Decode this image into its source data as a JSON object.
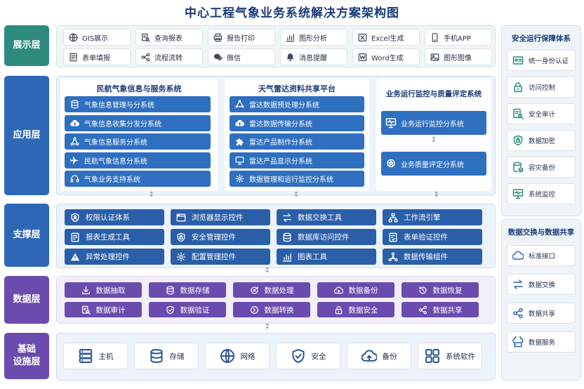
{
  "title": "中心工程气象业务系统解决方案架构图",
  "colors": {
    "teal": "#2f8a7e",
    "blue": "#2d67b5",
    "purple": "#6b4bae",
    "btn_blue": "#2f6fc0"
  },
  "layers": {
    "display": "展示层",
    "application": "应用层",
    "support": "支撑层",
    "data": "数据层",
    "infra_line1": "基础",
    "infra_line2": "设施层"
  },
  "display_items": [
    {
      "label": "GIS展示",
      "icon": "globe-icon"
    },
    {
      "label": "查询报表",
      "icon": "search-report-icon"
    },
    {
      "label": "报告打印",
      "icon": "printer-icon"
    },
    {
      "label": "图形分析",
      "icon": "bar-chart-icon"
    },
    {
      "label": "Excel生成",
      "icon": "excel-icon"
    },
    {
      "label": "手机APP",
      "icon": "phone-icon"
    },
    {
      "label": "表单填报",
      "icon": "form-icon"
    },
    {
      "label": "流程流转",
      "icon": "flow-icon"
    },
    {
      "label": "微信",
      "icon": "wechat-icon"
    },
    {
      "label": "消息提醒",
      "icon": "bell-icon"
    },
    {
      "label": "Word生成",
      "icon": "word-icon"
    },
    {
      "label": "图形图像",
      "icon": "image-icon"
    }
  ],
  "app": {
    "civil": {
      "title": "民航气象信息与服务系统",
      "items": [
        {
          "label": "气象信息管理与分系统",
          "icon": "database-icon"
        },
        {
          "label": "气象信息收集分发分系统",
          "icon": "cloud-upload-icon"
        },
        {
          "label": "气象信息服务分系统",
          "icon": "network-icon"
        },
        {
          "label": "民航气象信息分系统",
          "icon": "airplane-icon"
        },
        {
          "label": "气象业务支持系统",
          "icon": "headset-icon"
        }
      ]
    },
    "radar": {
      "title": "天气雷达资料共享平台",
      "items": [
        {
          "label": "雷达数据预处理分系统",
          "icon": "nodes-icon"
        },
        {
          "label": "雷达数据传输分系统",
          "icon": "cloud-upload-icon"
        },
        {
          "label": "雷达产品制作分系统",
          "icon": "puzzle-icon"
        },
        {
          "label": "雷达产品显示分系统",
          "icon": "monitor-icon"
        },
        {
          "label": "数据管理和运行监控分系统",
          "icon": "gear-icon"
        }
      ]
    },
    "monitor": {
      "title": "业务运行监控与质量评定系统",
      "items": [
        {
          "label": "业务运行监控分系统",
          "icon": "monitor-pulse-icon"
        },
        {
          "label": "业务质量评定分系统",
          "icon": "medal-icon"
        }
      ]
    }
  },
  "support_items": [
    {
      "label": "权限认证体系",
      "icon": "user-shield-icon"
    },
    {
      "label": "浏览器显示控件",
      "icon": "browser-icon"
    },
    {
      "label": "数据交换工具",
      "icon": "exchange-icon"
    },
    {
      "label": "工作流引擎",
      "icon": "workflow-icon"
    },
    {
      "label": "报表生成工具",
      "icon": "report-icon"
    },
    {
      "label": "安全管理控件",
      "icon": "shield-lock-icon"
    },
    {
      "label": "数据库访问控件",
      "icon": "database-icon"
    },
    {
      "label": "表单验证控件",
      "icon": "form-check-icon"
    },
    {
      "label": "异常处理控件",
      "icon": "warning-icon"
    },
    {
      "label": "配置管理控件",
      "icon": "gear-icon"
    },
    {
      "label": "图表工具",
      "icon": "chart-icon"
    },
    {
      "label": "数据传输组件",
      "icon": "share-nodes-icon"
    }
  ],
  "data_items": [
    {
      "label": "数据抽取",
      "icon": "download-icon"
    },
    {
      "label": "数据存储",
      "icon": "database-icon"
    },
    {
      "label": "数据处理",
      "icon": "process-icon"
    },
    {
      "label": "数据备份",
      "icon": "cloud-backup-icon"
    },
    {
      "label": "数据恢复",
      "icon": "restore-icon"
    },
    {
      "label": "数据审计",
      "icon": "audit-icon"
    },
    {
      "label": "数据验证",
      "icon": "check-shield-icon"
    },
    {
      "label": "数据转换",
      "icon": "convert-icon"
    },
    {
      "label": "数据安全",
      "icon": "lock-icon"
    },
    {
      "label": "数据共享",
      "icon": "share-icon"
    }
  ],
  "infra_items": [
    {
      "label": "主机",
      "icon": "server-icon"
    },
    {
      "label": "存储",
      "icon": "storage-icon"
    },
    {
      "label": "网络",
      "icon": "globe-icon"
    },
    {
      "label": "安全",
      "icon": "shield-check-icon"
    },
    {
      "label": "备份",
      "icon": "cloud-backup-icon"
    },
    {
      "label": "系统软件",
      "icon": "apps-icon"
    }
  ],
  "security": {
    "title": "安全运行保障体系",
    "items": [
      {
        "label": "统一身份认证",
        "icon": "id-card-icon"
      },
      {
        "label": "访问控制",
        "icon": "lock-icon"
      },
      {
        "label": "安全审计",
        "icon": "audit-icon"
      },
      {
        "label": "数据加密",
        "icon": "shield-lock-icon"
      },
      {
        "label": "容灾备份",
        "icon": "database-check-icon"
      },
      {
        "label": "系统监控",
        "icon": "monitor-pulse-icon"
      }
    ]
  },
  "exchange": {
    "title": "数据交换与数据共享",
    "items": [
      {
        "label": "标准接口",
        "icon": "api-cloud-icon"
      },
      {
        "label": "数据交换",
        "icon": "exchange-icon"
      },
      {
        "label": "数据共享",
        "icon": "share-icon"
      },
      {
        "label": "数据服务",
        "icon": "cloud-server-icon"
      }
    ]
  }
}
